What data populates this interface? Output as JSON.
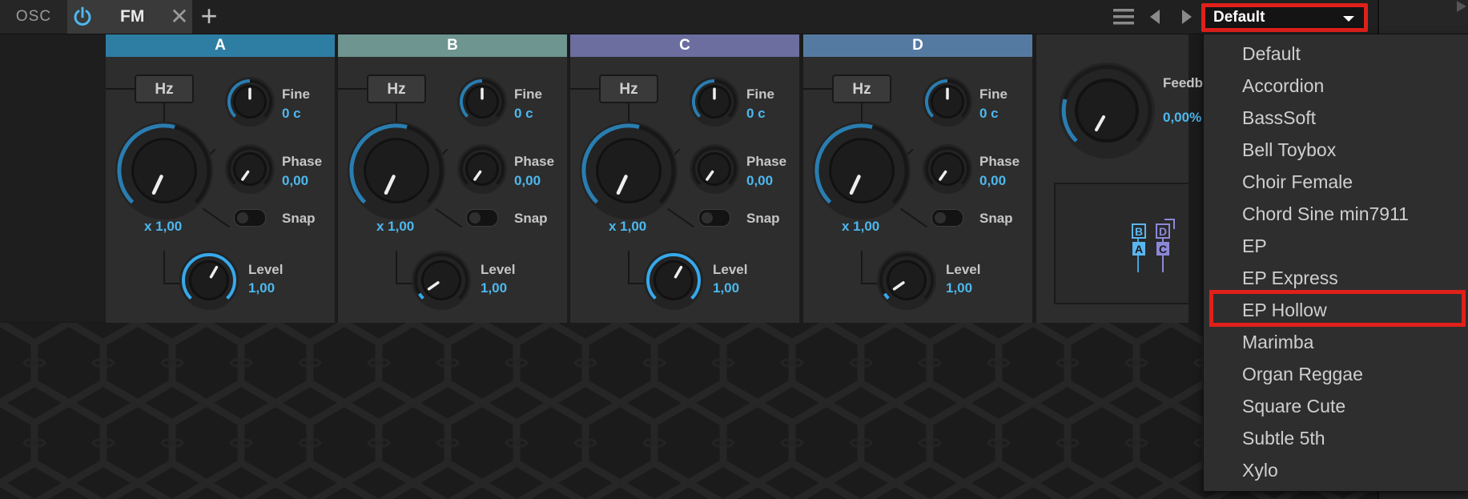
{
  "window": {
    "tab_section_label": "OSC",
    "active_tab_label": "FM"
  },
  "preset": {
    "selected": "Default",
    "options": [
      "Default",
      "Accordion",
      "BassSoft",
      "Bell Toybox",
      "Choir Female",
      "Chord Sine min7911",
      "EP",
      "EP Express",
      "EP Hollow",
      "Marimba",
      "Organ Reggae",
      "Square Cute",
      "Subtle 5th",
      "Xylo"
    ],
    "highlighted": "EP Hollow"
  },
  "operators": [
    {
      "name": "A",
      "ratio_mode": "Hz",
      "ratio": "x 1,00",
      "fine_label": "Fine",
      "fine": "0 c",
      "phase_label": "Phase",
      "phase": "0,00",
      "snap_label": "Snap",
      "level_label": "Level",
      "level": "1,00",
      "level_fraction": 1.0,
      "header_color": "#2e7ea3"
    },
    {
      "name": "B",
      "ratio_mode": "Hz",
      "ratio": "x 1,00",
      "fine_label": "Fine",
      "fine": "0 c",
      "phase_label": "Phase",
      "phase": "0,00",
      "snap_label": "Snap",
      "level_label": "Level",
      "level": "1,00",
      "level_fraction": 0.05,
      "header_color": "#6e958f"
    },
    {
      "name": "C",
      "ratio_mode": "Hz",
      "ratio": "x 1,00",
      "fine_label": "Fine",
      "fine": "0 c",
      "phase_label": "Phase",
      "phase": "0,00",
      "snap_label": "Snap",
      "level_label": "Level",
      "level": "1,00",
      "level_fraction": 1.0,
      "header_color": "#6c6ea0"
    },
    {
      "name": "D",
      "ratio_mode": "Hz",
      "ratio": "x 1,00",
      "fine_label": "Fine",
      "fine": "0 c",
      "phase_label": "Phase",
      "phase": "0,00",
      "snap_label": "Snap",
      "level_label": "Level",
      "level": "1,00",
      "level_fraction": 0.05,
      "header_color": "#557aa2"
    }
  ],
  "feedback": {
    "label": "Feedb",
    "value": "0,00%"
  },
  "algorithm": {
    "a": "A",
    "b": "B",
    "c": "C",
    "d": "D"
  },
  "colors": {
    "accent": "#4db8ee",
    "highlight": "#e0201a"
  },
  "icons": [
    "power-icon",
    "close-icon",
    "plus-icon",
    "menu-icon",
    "prev-arrow-icon",
    "next-arrow-icon",
    "dropdown-caret-icon"
  ]
}
